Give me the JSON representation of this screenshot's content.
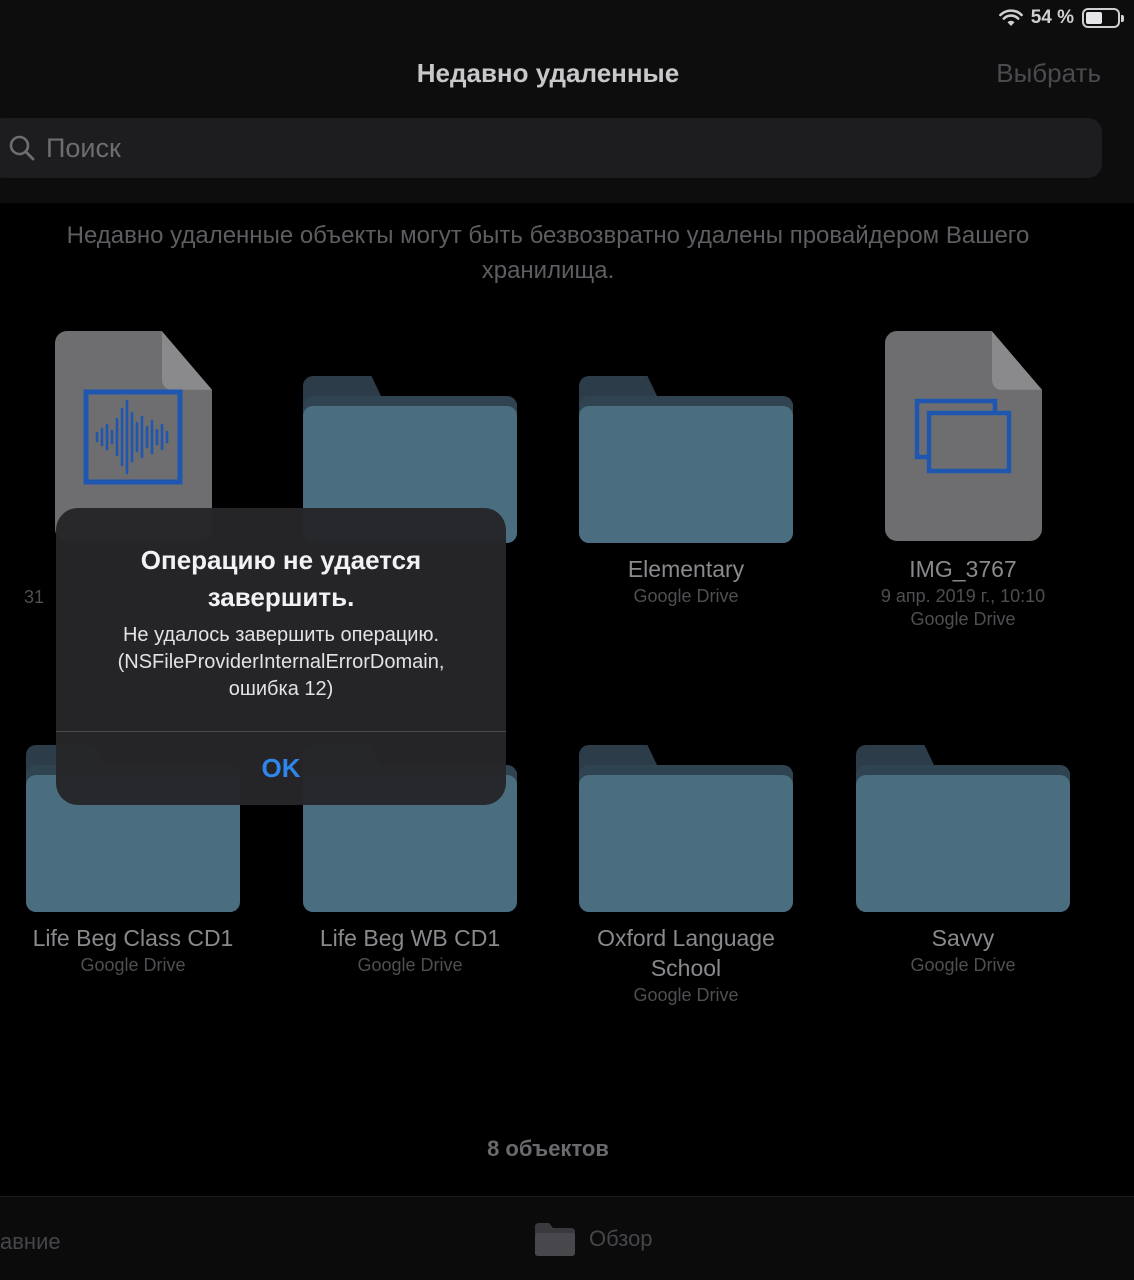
{
  "status": {
    "wifi_icon": "wifi-icon",
    "battery_percent": "54 %",
    "battery_level": 0.54
  },
  "nav": {
    "title": "Недавно удаленные",
    "select_label": "Выбрать"
  },
  "search": {
    "placeholder": "Поиск"
  },
  "notice": "Недавно удаленные объекты могут быть безвозвратно удалены провайдером Вашего хранилища.",
  "items": [
    {
      "kind": "document-audio",
      "name": "",
      "meta_date": "31",
      "meta_source": ""
    },
    {
      "kind": "folder",
      "name": "",
      "meta_source": ""
    },
    {
      "kind": "folder",
      "name": "Elementary",
      "meta_source": "Google Drive"
    },
    {
      "kind": "document-image",
      "name": "IMG_3767",
      "meta_date": "9 апр. 2019 г., 10:10",
      "meta_source": "Google Drive"
    },
    {
      "kind": "folder",
      "name": "Life Beg Class CD1",
      "meta_source": "Google Drive"
    },
    {
      "kind": "folder",
      "name": "Life Beg WB CD1",
      "meta_source": "Google Drive"
    },
    {
      "kind": "folder",
      "name": "Oxford Language School",
      "meta_source": "Google Drive"
    },
    {
      "kind": "folder",
      "name": "Savvy",
      "meta_source": "Google Drive"
    }
  ],
  "alert": {
    "title": "Операцию не удается завершить.",
    "message": "Не удалось завершить операцию. (NSFileProviderInternalErrorDomain, ошибка 12)",
    "ok_label": "OK"
  },
  "footer": {
    "count": "8 объектов"
  },
  "tabbar": {
    "recent_label": "авние",
    "browse_label": "Обзор"
  },
  "colors": {
    "accent": "#2f86ea",
    "folder": "#4a6d80",
    "document": "#6e6e70",
    "doc_glyph": "#1f57b0"
  }
}
